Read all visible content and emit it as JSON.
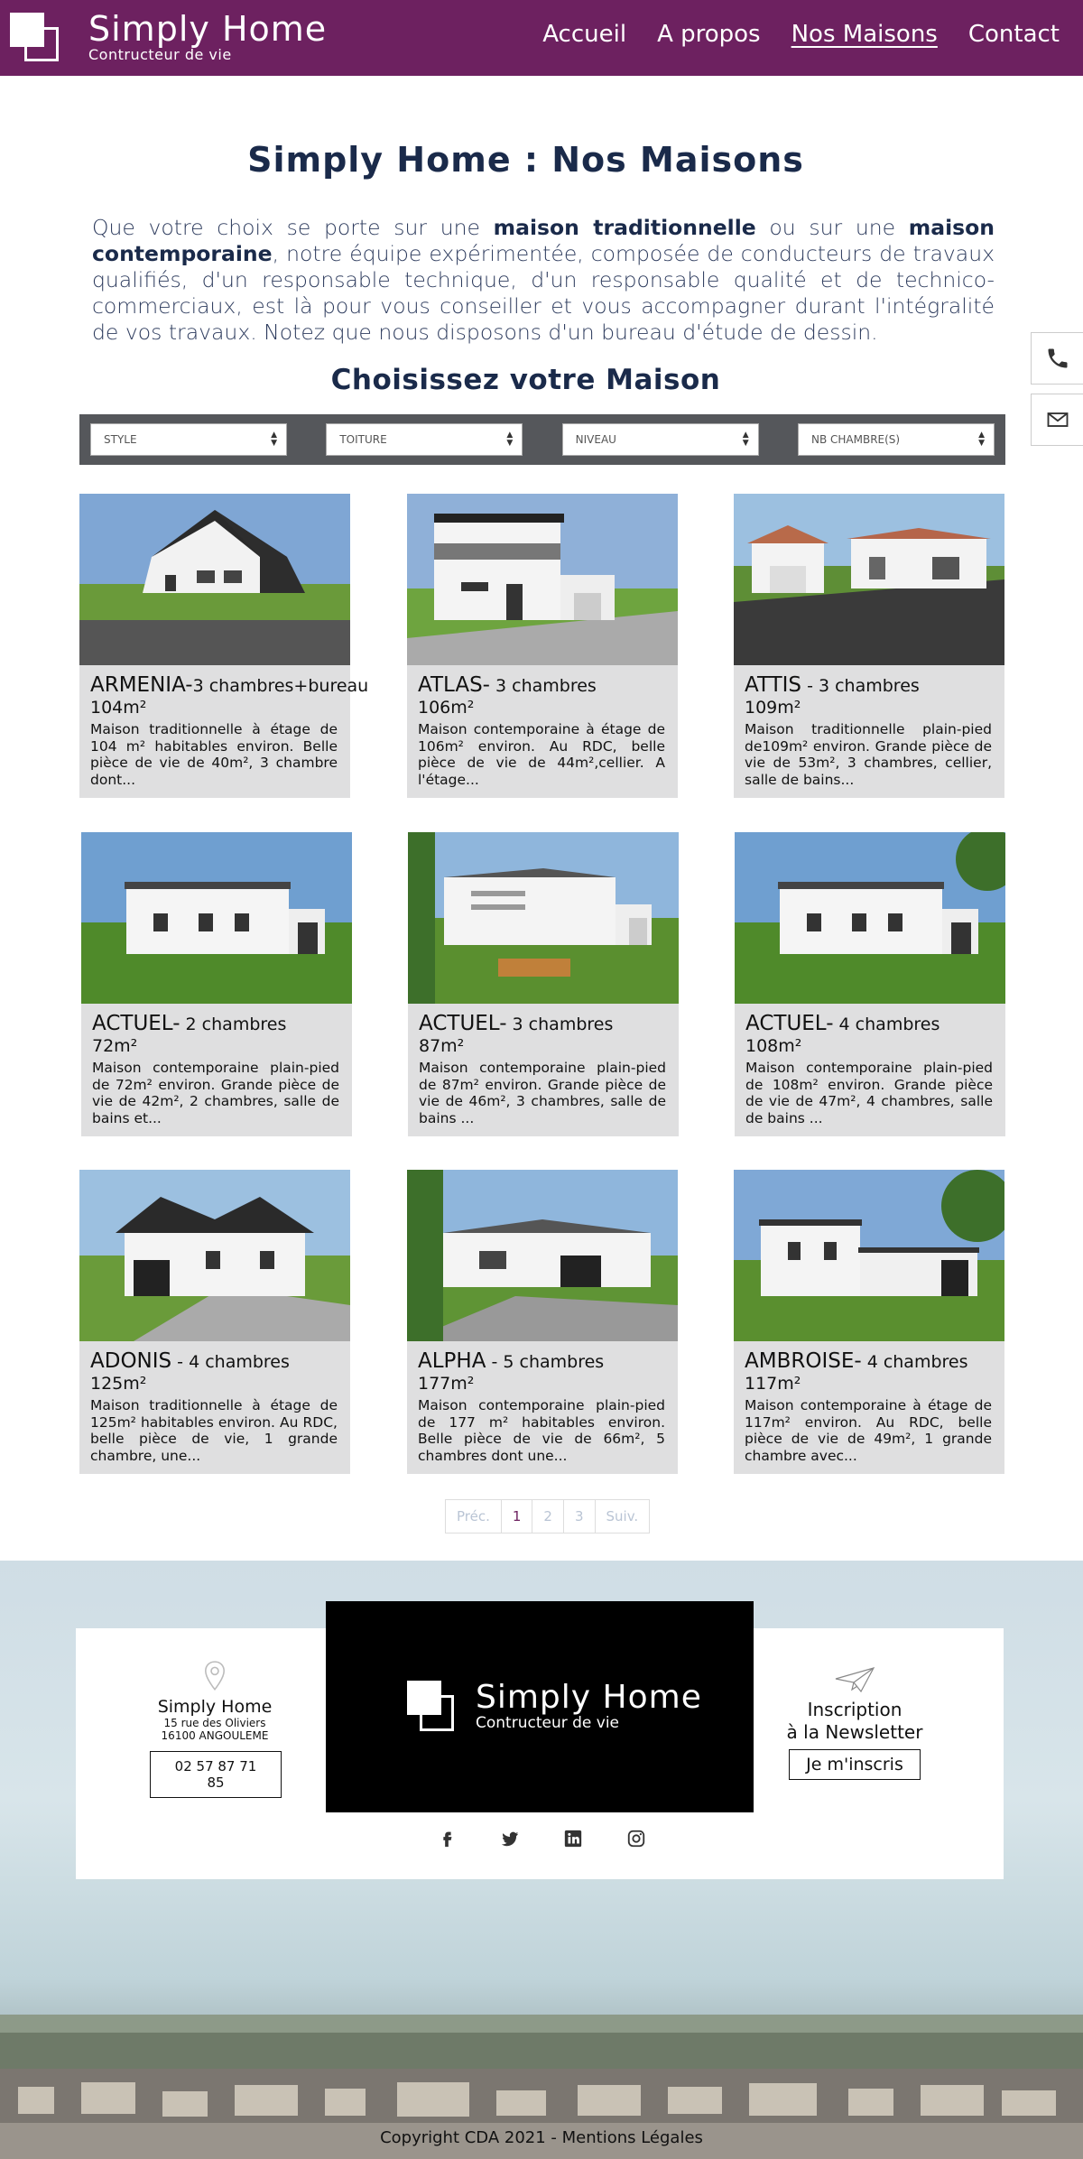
{
  "header": {
    "brand_name": "Simply Home",
    "brand_tagline": "Contructeur de vie",
    "nav": [
      {
        "label": "Accueil"
      },
      {
        "label": "A propos"
      },
      {
        "label": "Nos Maisons"
      },
      {
        "label": "Contact"
      }
    ]
  },
  "side": {
    "phone_icon": "phone-icon",
    "mail_icon": "mail-icon"
  },
  "main": {
    "title": "Simply Home : Nos Maisons",
    "intro_1": "Que votre choix se porte sur une ",
    "intro_b1": "maison traditionnelle",
    "intro_2": " ou sur une ",
    "intro_b2": "maison contemporaine",
    "intro_3": ", notre équipe expérimentée, composée de conducteurs de travaux qualifiés, d'un responsable technique, d'un responsable qualité et de technico-commerciaux, est là pour vous conseiller et vous accompagner durant l'intégralité de vos travaux. Notez que nous disposons d'un bureau d'étude de dessin.",
    "choose_title": "Choisissez votre Maison"
  },
  "filters": [
    {
      "label": "STYLE"
    },
    {
      "label": "TOITURE"
    },
    {
      "label": "NIVEAU"
    },
    {
      "label": "NB CHAMBRE(S)"
    }
  ],
  "houses": [
    {
      "name": "ARMENIA-",
      "rooms": "3 chambres+bureau",
      "area": "104m²",
      "desc": "Maison traditionnelle à étage de 104 m² habitables environ. Belle pièce de vie de 40m², 3 chambre dont..."
    },
    {
      "name": "ATLAS-",
      "rooms": " 3 chambres",
      "area": "106m²",
      "desc": "Maison contemporaine à étage de 106m² environ. Au RDC, belle pièce de vie de 44m²,cellier. A l'étage..."
    },
    {
      "name": "ATTIS",
      "rooms": " - 3 chambres",
      "area": "109m²",
      "desc": "Maison traditionnelle plain-pied de109m² environ. Grande pièce de vie de 53m², 3 chambres, cellier, salle de bains..."
    },
    {
      "name": "ACTUEL-",
      "rooms": " 2 chambres",
      "area": "72m²",
      "desc": "Maison contemporaine plain-pied de 72m² environ. Grande pièce de vie de 42m², 2 chambres, salle de bains et..."
    },
    {
      "name": "ACTUEL-",
      "rooms": " 3 chambres",
      "area": "87m²",
      "desc": "Maison contemporaine plain-pied de 87m² environ. Grande pièce de vie de 46m², 3 chambres, salle de bains ..."
    },
    {
      "name": "ACTUEL-",
      "rooms": " 4 chambres",
      "area": "108m²",
      "desc": "Maison contemporaine plain-pied de 108m² environ. Grande pièce de vie de 47m², 4 chambres, salle de bains ..."
    },
    {
      "name": "ADONIS",
      "rooms": " - 4 chambres",
      "area": "125m²",
      "desc": "Maison traditionnelle à étage de 125m² habitables environ. Au RDC, belle pièce de vie, 1 grande chambre, une..."
    },
    {
      "name": "ALPHA",
      "rooms": " - 5 chambres",
      "area": "177m²",
      "desc": "Maison contemporaine plain-pied de 177 m² habitables environ. Belle pièce de vie de 66m², 5 chambres dont une..."
    },
    {
      "name": "AMBROISE-",
      "rooms": " 4 chambres",
      "area": "117m²",
      "desc": "Maison contemporaine à étage de 117m² environ. Au RDC, belle pièce de vie de 49m², 1 grande chambre avec..."
    }
  ],
  "pager": {
    "prev": "Préc.",
    "p1": "1",
    "p2": "2",
    "p3": "3",
    "next": "Suiv."
  },
  "footer": {
    "addr_name": "Simply Home",
    "addr_line1": "15 rue des Oliviers",
    "addr_line2": "16100 ANGOULEME",
    "phone": "02 57 87 71 85",
    "brand_name": "Simply Home",
    "brand_tagline": "Contructeur de vie",
    "news_line1": "Inscription",
    "news_line2": "à la Newsletter",
    "news_button": "Je m'inscris",
    "copyright": "Copyright CDA 2021 - Mentions Légales"
  },
  "colors": {
    "brand": "#6d2160",
    "filter_bar": "#55575b",
    "card_bg": "#dfdfe0"
  }
}
